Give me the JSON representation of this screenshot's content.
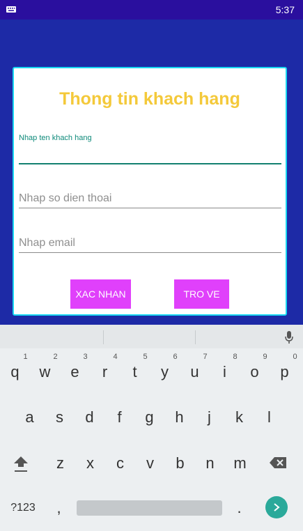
{
  "status_bar": {
    "time": "5:37",
    "left_icon": "keyboard-icon"
  },
  "form": {
    "title": "Thong tin khach hang",
    "name_label": "Nhap ten khach hang",
    "name_value": "",
    "phone_placeholder": "Nhap so dien thoai",
    "email_placeholder": "Nhap email",
    "confirm_label": "XAC NHAN",
    "back_label": "TRO VE",
    "accent_color": "#e040fb",
    "title_color": "#f4c93a"
  },
  "keyboard": {
    "row1": [
      {
        "k": "q",
        "h": "1"
      },
      {
        "k": "w",
        "h": "2"
      },
      {
        "k": "e",
        "h": "3"
      },
      {
        "k": "r",
        "h": "4"
      },
      {
        "k": "t",
        "h": "5"
      },
      {
        "k": "y",
        "h": "6"
      },
      {
        "k": "u",
        "h": "7"
      },
      {
        "k": "i",
        "h": "8"
      },
      {
        "k": "o",
        "h": "9"
      },
      {
        "k": "p",
        "h": "0"
      }
    ],
    "row2": [
      "a",
      "s",
      "d",
      "f",
      "g",
      "h",
      "j",
      "k",
      "l"
    ],
    "row3": [
      "z",
      "x",
      "c",
      "v",
      "b",
      "n",
      "m"
    ],
    "symbols_label": "?123",
    "comma": ",",
    "period": ".",
    "shift_icon": "shift-icon",
    "backspace_icon": "backspace-icon",
    "mic_icon": "mic-icon",
    "enter_icon": "next-arrow-icon"
  }
}
